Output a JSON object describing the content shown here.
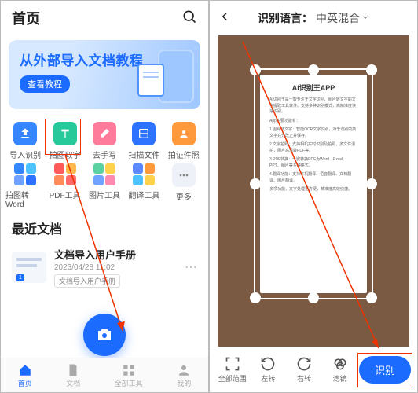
{
  "left": {
    "title": "首页",
    "banner": {
      "title": "从外部导入文档教程",
      "button": "查看教程"
    },
    "grid": [
      {
        "label": "导入识别"
      },
      {
        "label": "拍图取字"
      },
      {
        "label": "去手写"
      },
      {
        "label": "扫描文件"
      },
      {
        "label": "拍证件照"
      },
      {
        "label": "拍图转Word"
      },
      {
        "label": "PDF工具"
      },
      {
        "label": "图片工具"
      },
      {
        "label": "翻译工具"
      },
      {
        "label": "更多"
      }
    ],
    "recent_title": "最近文档",
    "doc": {
      "name": "文档导入用户手册",
      "date": "2023/04/28 11:02",
      "tag": "文档导入用户手册",
      "badge": "1"
    },
    "bottom": [
      {
        "label": "首页"
      },
      {
        "label": "文档"
      },
      {
        "label": "全部工具"
      },
      {
        "label": "我的"
      }
    ]
  },
  "right": {
    "lang_label": "识别语言：",
    "lang_value": "中英混合",
    "paper_title": "AI识别王APP",
    "bottom": [
      {
        "label": "全部范围"
      },
      {
        "label": "左转"
      },
      {
        "label": "右转"
      },
      {
        "label": "滤镜"
      }
    ],
    "action": "识别"
  }
}
